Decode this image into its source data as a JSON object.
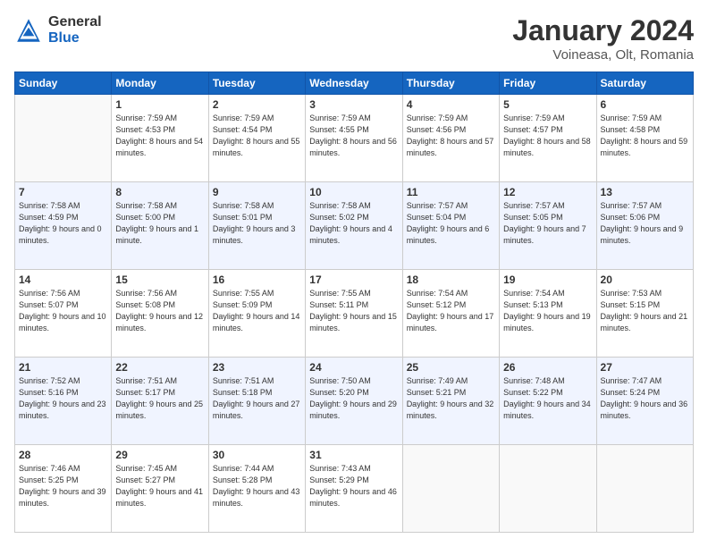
{
  "logo": {
    "general": "General",
    "blue": "Blue"
  },
  "header": {
    "title": "January 2024",
    "subtitle": "Voineasa, Olt, Romania"
  },
  "weekdays": [
    "Sunday",
    "Monday",
    "Tuesday",
    "Wednesday",
    "Thursday",
    "Friday",
    "Saturday"
  ],
  "weeks": [
    [
      {
        "day": "",
        "sunrise": "",
        "sunset": "",
        "daylight": ""
      },
      {
        "day": "1",
        "sunrise": "Sunrise: 7:59 AM",
        "sunset": "Sunset: 4:53 PM",
        "daylight": "Daylight: 8 hours and 54 minutes."
      },
      {
        "day": "2",
        "sunrise": "Sunrise: 7:59 AM",
        "sunset": "Sunset: 4:54 PM",
        "daylight": "Daylight: 8 hours and 55 minutes."
      },
      {
        "day": "3",
        "sunrise": "Sunrise: 7:59 AM",
        "sunset": "Sunset: 4:55 PM",
        "daylight": "Daylight: 8 hours and 56 minutes."
      },
      {
        "day": "4",
        "sunrise": "Sunrise: 7:59 AM",
        "sunset": "Sunset: 4:56 PM",
        "daylight": "Daylight: 8 hours and 57 minutes."
      },
      {
        "day": "5",
        "sunrise": "Sunrise: 7:59 AM",
        "sunset": "Sunset: 4:57 PM",
        "daylight": "Daylight: 8 hours and 58 minutes."
      },
      {
        "day": "6",
        "sunrise": "Sunrise: 7:59 AM",
        "sunset": "Sunset: 4:58 PM",
        "daylight": "Daylight: 8 hours and 59 minutes."
      }
    ],
    [
      {
        "day": "7",
        "sunrise": "Sunrise: 7:58 AM",
        "sunset": "Sunset: 4:59 PM",
        "daylight": "Daylight: 9 hours and 0 minutes."
      },
      {
        "day": "8",
        "sunrise": "Sunrise: 7:58 AM",
        "sunset": "Sunset: 5:00 PM",
        "daylight": "Daylight: 9 hours and 1 minute."
      },
      {
        "day": "9",
        "sunrise": "Sunrise: 7:58 AM",
        "sunset": "Sunset: 5:01 PM",
        "daylight": "Daylight: 9 hours and 3 minutes."
      },
      {
        "day": "10",
        "sunrise": "Sunrise: 7:58 AM",
        "sunset": "Sunset: 5:02 PM",
        "daylight": "Daylight: 9 hours and 4 minutes."
      },
      {
        "day": "11",
        "sunrise": "Sunrise: 7:57 AM",
        "sunset": "Sunset: 5:04 PM",
        "daylight": "Daylight: 9 hours and 6 minutes."
      },
      {
        "day": "12",
        "sunrise": "Sunrise: 7:57 AM",
        "sunset": "Sunset: 5:05 PM",
        "daylight": "Daylight: 9 hours and 7 minutes."
      },
      {
        "day": "13",
        "sunrise": "Sunrise: 7:57 AM",
        "sunset": "Sunset: 5:06 PM",
        "daylight": "Daylight: 9 hours and 9 minutes."
      }
    ],
    [
      {
        "day": "14",
        "sunrise": "Sunrise: 7:56 AM",
        "sunset": "Sunset: 5:07 PM",
        "daylight": "Daylight: 9 hours and 10 minutes."
      },
      {
        "day": "15",
        "sunrise": "Sunrise: 7:56 AM",
        "sunset": "Sunset: 5:08 PM",
        "daylight": "Daylight: 9 hours and 12 minutes."
      },
      {
        "day": "16",
        "sunrise": "Sunrise: 7:55 AM",
        "sunset": "Sunset: 5:09 PM",
        "daylight": "Daylight: 9 hours and 14 minutes."
      },
      {
        "day": "17",
        "sunrise": "Sunrise: 7:55 AM",
        "sunset": "Sunset: 5:11 PM",
        "daylight": "Daylight: 9 hours and 15 minutes."
      },
      {
        "day": "18",
        "sunrise": "Sunrise: 7:54 AM",
        "sunset": "Sunset: 5:12 PM",
        "daylight": "Daylight: 9 hours and 17 minutes."
      },
      {
        "day": "19",
        "sunrise": "Sunrise: 7:54 AM",
        "sunset": "Sunset: 5:13 PM",
        "daylight": "Daylight: 9 hours and 19 minutes."
      },
      {
        "day": "20",
        "sunrise": "Sunrise: 7:53 AM",
        "sunset": "Sunset: 5:15 PM",
        "daylight": "Daylight: 9 hours and 21 minutes."
      }
    ],
    [
      {
        "day": "21",
        "sunrise": "Sunrise: 7:52 AM",
        "sunset": "Sunset: 5:16 PM",
        "daylight": "Daylight: 9 hours and 23 minutes."
      },
      {
        "day": "22",
        "sunrise": "Sunrise: 7:51 AM",
        "sunset": "Sunset: 5:17 PM",
        "daylight": "Daylight: 9 hours and 25 minutes."
      },
      {
        "day": "23",
        "sunrise": "Sunrise: 7:51 AM",
        "sunset": "Sunset: 5:18 PM",
        "daylight": "Daylight: 9 hours and 27 minutes."
      },
      {
        "day": "24",
        "sunrise": "Sunrise: 7:50 AM",
        "sunset": "Sunset: 5:20 PM",
        "daylight": "Daylight: 9 hours and 29 minutes."
      },
      {
        "day": "25",
        "sunrise": "Sunrise: 7:49 AM",
        "sunset": "Sunset: 5:21 PM",
        "daylight": "Daylight: 9 hours and 32 minutes."
      },
      {
        "day": "26",
        "sunrise": "Sunrise: 7:48 AM",
        "sunset": "Sunset: 5:22 PM",
        "daylight": "Daylight: 9 hours and 34 minutes."
      },
      {
        "day": "27",
        "sunrise": "Sunrise: 7:47 AM",
        "sunset": "Sunset: 5:24 PM",
        "daylight": "Daylight: 9 hours and 36 minutes."
      }
    ],
    [
      {
        "day": "28",
        "sunrise": "Sunrise: 7:46 AM",
        "sunset": "Sunset: 5:25 PM",
        "daylight": "Daylight: 9 hours and 39 minutes."
      },
      {
        "day": "29",
        "sunrise": "Sunrise: 7:45 AM",
        "sunset": "Sunset: 5:27 PM",
        "daylight": "Daylight: 9 hours and 41 minutes."
      },
      {
        "day": "30",
        "sunrise": "Sunrise: 7:44 AM",
        "sunset": "Sunset: 5:28 PM",
        "daylight": "Daylight: 9 hours and 43 minutes."
      },
      {
        "day": "31",
        "sunrise": "Sunrise: 7:43 AM",
        "sunset": "Sunset: 5:29 PM",
        "daylight": "Daylight: 9 hours and 46 minutes."
      },
      {
        "day": "",
        "sunrise": "",
        "sunset": "",
        "daylight": ""
      },
      {
        "day": "",
        "sunrise": "",
        "sunset": "",
        "daylight": ""
      },
      {
        "day": "",
        "sunrise": "",
        "sunset": "",
        "daylight": ""
      }
    ]
  ]
}
